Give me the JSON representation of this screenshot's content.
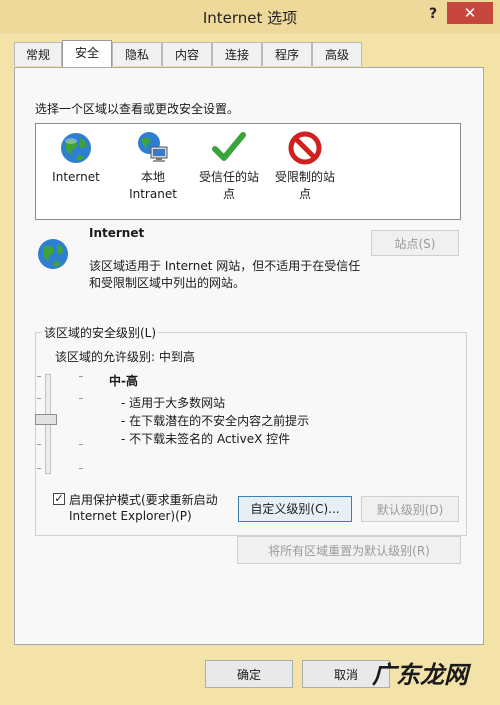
{
  "window": {
    "title": "Internet 选项",
    "help": "?",
    "close": "✕"
  },
  "tabs": [
    {
      "label": "常规"
    },
    {
      "label": "安全"
    },
    {
      "label": "隐私"
    },
    {
      "label": "内容"
    },
    {
      "label": "连接"
    },
    {
      "label": "程序"
    },
    {
      "label": "高级"
    }
  ],
  "active_tab": "安全",
  "security": {
    "instruction": "选择一个区域以查看或更改安全设置。",
    "zones": [
      {
        "line1": "Internet",
        "line2": "",
        "icon": "globe-icon"
      },
      {
        "line1": "本地",
        "line2": "Intranet",
        "icon": "local-intranet-icon"
      },
      {
        "line1": "受信任的站",
        "line2": "点",
        "icon": "checkmark-icon"
      },
      {
        "line1": "受限制的站",
        "line2": "点",
        "icon": "restricted-icon"
      }
    ],
    "selected_zone": {
      "name": "Internet",
      "desc_line1": "该区域适用于 Internet 网站，但不适用于在受信任",
      "desc_line2": "和受限制区域中列出的网站。",
      "sites_button": "站点(S)"
    },
    "level_group": {
      "legend": "该区域的安全级别(L)",
      "allowed": "该区域的允许级别: 中到高",
      "level_name": "中-高",
      "bullets": [
        "- 适用于大多数网站",
        "- 在下载潜在的不安全内容之前提示",
        "- 不下载未签名的 ActiveX 控件"
      ],
      "slider_level": 0.5
    },
    "protected_mode": {
      "checked": true,
      "check_mark": "✓",
      "line1": "启用保护模式(要求重新启动",
      "line2": "Internet Explorer)(P)"
    },
    "custom_level_button": "自定义级别(C)...",
    "default_level_button": "默认级别(D)",
    "reset_all_button": "将所有区域重置为默认级别(R)"
  },
  "footer": {
    "ok": "确定",
    "cancel": "取消",
    "watermark": "广东龙网"
  },
  "colors": {
    "accent": "#3c7fb1",
    "close": "#c7463e",
    "frame": "#f3e3a8"
  }
}
